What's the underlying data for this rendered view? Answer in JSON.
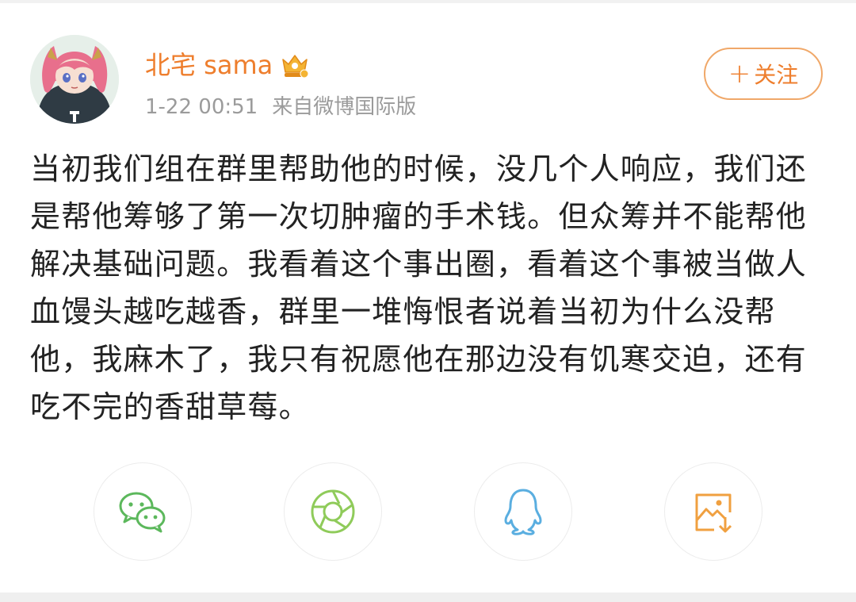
{
  "post": {
    "username": "北宅 sama",
    "time": "1-22 00:51",
    "source": "来自微博国际版",
    "follow_label": "关注",
    "text": "当初我们组在群里帮助他的时候，没几个人响应，我们还是帮他筹够了第一次切肿瘤的手术钱。但众筹并不能帮他解决基础问题。我看着这个事出圈，看着这个事被当做人血馒头越吃越香，群里一堆悔恨者说着当初为什么没帮他，我麻木了，我只有祝愿他在那边没有饥寒交迫，还有吃不完的香甜草莓。"
  },
  "icons": {
    "verified": "crown-badge-icon",
    "follow": "plus-icon",
    "share": [
      "wechat-icon",
      "moments-icon",
      "qq-icon",
      "save-image-icon"
    ]
  },
  "colors": {
    "accent": "#ee7e2d",
    "follow_border": "#f0a869",
    "meta": "#9b9b9b",
    "text": "#222222",
    "wechat": "#5cb85c",
    "moments": "#8fcb5a",
    "qq": "#5aaee0",
    "save": "#f0a040"
  }
}
